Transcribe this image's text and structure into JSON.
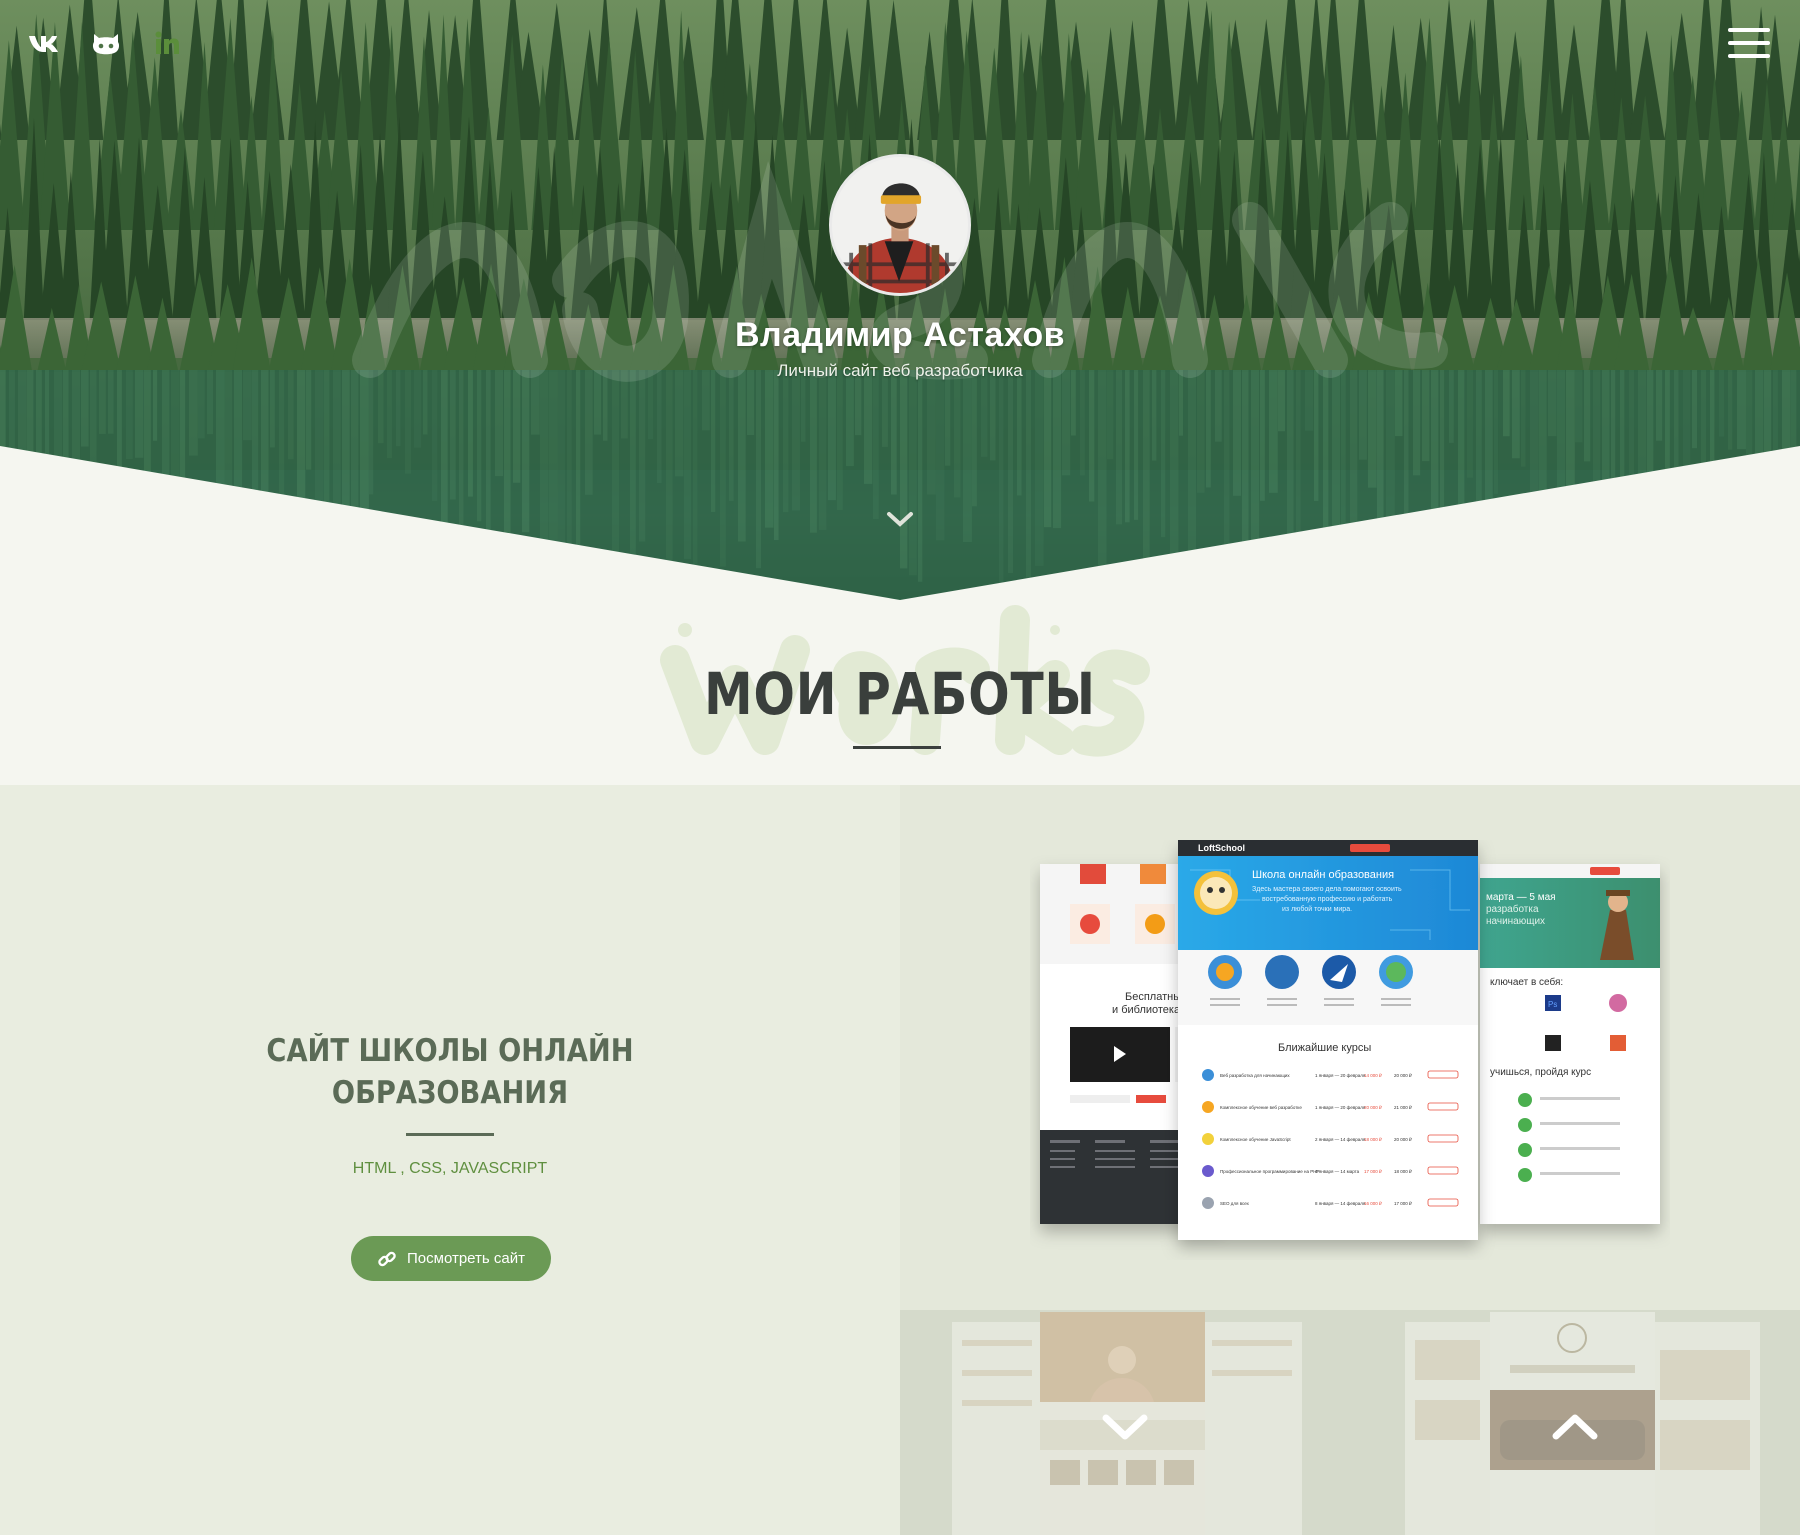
{
  "header": {
    "social": [
      {
        "name": "vk-icon",
        "label": "VK"
      },
      {
        "name": "github-icon",
        "label": "GitHub"
      },
      {
        "name": "linkedin-icon",
        "label": "LinkedIn"
      }
    ],
    "menu_icon": "hamburger-icon"
  },
  "hero": {
    "name": "Владимир Астахов",
    "subtitle": "Личный сайт веб разработчика",
    "scroll_icon": "chevron-down-icon"
  },
  "works": {
    "title": "МОИ РАБОТЫ",
    "background_word": "works"
  },
  "project": {
    "title_line1": "САЙТ ШКОЛЫ ОНЛАЙН",
    "title_line2": "ОБРАЗОВАНИЯ",
    "tech": "HTML , CSS, JAVASCRIPT",
    "button_label": "Посмотреть сайт",
    "button_icon": "link-icon"
  },
  "mockup": {
    "brand": "LoftSchool",
    "hero_title": "Школа онлайн образования",
    "hero_text_1": "Здесь мастера своего дела помогают освоить",
    "hero_text_2": "востребованную профессию и работать",
    "hero_text_3": "из любой точки мира.",
    "courses_title": "Ближайшие курсы",
    "courses": [
      {
        "name": "Веб разработка для начинающих",
        "dates": "1 января — 20 февраля",
        "price": "14 000 ₽",
        "price2": "20 000 ₽"
      },
      {
        "name": "Комплексное обучение веб разработке",
        "dates": "1 января — 20 февраля",
        "price": "20 000 ₽",
        "price2": "21 000 ₽"
      },
      {
        "name": "Комплексное обучение JavaScript",
        "dates": "2 января — 14 февраля",
        "price": "18 000 ₽",
        "price2": "20 000 ₽"
      },
      {
        "name": "Профессиональное программирование на PHP",
        "dates": "4 января — 14 марта",
        "price": "17 000 ₽",
        "price2": "18 000 ₽"
      },
      {
        "name": "SEO для всех",
        "dates": "8 января — 14 февраля",
        "price": "16 000 ₽",
        "price2": "17 000 ₽"
      }
    ],
    "left_heading_1": "Бесплатные веб",
    "left_heading_2": "и библиотека з",
    "right_heading": "марта — 5 мая",
    "right_sub_1": "разработка",
    "right_sub_2": "начинающих",
    "right_includes": "ключает в себя:",
    "right_learn": "учишься, пройдя курс"
  },
  "thumbs": [
    {
      "name": "prev-project-thumb",
      "arrow": "chevron-down-icon"
    },
    {
      "name": "next-project-thumb",
      "arrow": "chevron-up-icon"
    }
  ],
  "colors": {
    "accent_green": "#6b9a55",
    "title_dark": "#3a3f3c",
    "project_title": "#5b6b57",
    "tech_green": "#5f8f3f"
  }
}
